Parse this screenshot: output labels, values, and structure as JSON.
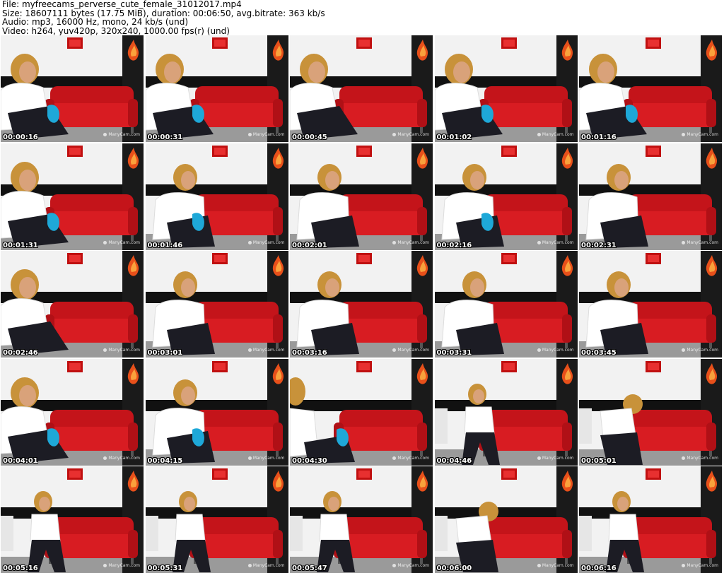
{
  "file_info": {
    "line1": "File: myfreecams_perverse_cute_female_31012017.mp4",
    "line2": "Size: 18607111 bytes (17.75 MiB), duration: 00:06:50, avg.bitrate: 363 kb/s",
    "line3": "Audio: mp3, 16000 Hz, mono, 24 kb/s (und)",
    "line4": "Video: h264, yuv420p, 320x240, 1000.00 fps(r) (und)"
  },
  "watermark": "ManyCam.com",
  "thumbnails": [
    {
      "timestamp": "00:00:16",
      "pose": "lean-left",
      "cloth": true
    },
    {
      "timestamp": "00:00:31",
      "pose": "lean-left",
      "cloth": true
    },
    {
      "timestamp": "00:00:45",
      "pose": "lean-left",
      "cloth": false
    },
    {
      "timestamp": "00:01:02",
      "pose": "lean-left",
      "cloth": true
    },
    {
      "timestamp": "00:01:16",
      "pose": "lean-left",
      "cloth": true
    },
    {
      "timestamp": "00:01:31",
      "pose": "close",
      "cloth": true
    },
    {
      "timestamp": "00:01:46",
      "pose": "center",
      "cloth": true
    },
    {
      "timestamp": "00:02:01",
      "pose": "center",
      "cloth": false
    },
    {
      "timestamp": "00:02:16",
      "pose": "center",
      "cloth": true
    },
    {
      "timestamp": "00:02:31",
      "pose": "center",
      "cloth": false
    },
    {
      "timestamp": "00:02:46",
      "pose": "lean-left",
      "cloth": false
    },
    {
      "timestamp": "00:03:01",
      "pose": "center",
      "cloth": false
    },
    {
      "timestamp": "00:03:16",
      "pose": "center",
      "cloth": false
    },
    {
      "timestamp": "00:03:31",
      "pose": "center",
      "cloth": false
    },
    {
      "timestamp": "00:03:45",
      "pose": "center",
      "cloth": false
    },
    {
      "timestamp": "00:04:01",
      "pose": "lean-left",
      "cloth": true
    },
    {
      "timestamp": "00:04:15",
      "pose": "center",
      "cloth": true
    },
    {
      "timestamp": "00:04:30",
      "pose": "edge",
      "cloth": true
    },
    {
      "timestamp": "00:04:46",
      "pose": "full",
      "cloth": false
    },
    {
      "timestamp": "00:05:01",
      "pose": "bent",
      "cloth": false
    },
    {
      "timestamp": "00:05:16",
      "pose": "full",
      "cloth": false
    },
    {
      "timestamp": "00:05:31",
      "pose": "full",
      "cloth": false
    },
    {
      "timestamp": "00:05:47",
      "pose": "full",
      "cloth": false
    },
    {
      "timestamp": "00:06:00",
      "pose": "bent",
      "cloth": false
    },
    {
      "timestamp": "00:06:16",
      "pose": "full",
      "cloth": false
    }
  ]
}
